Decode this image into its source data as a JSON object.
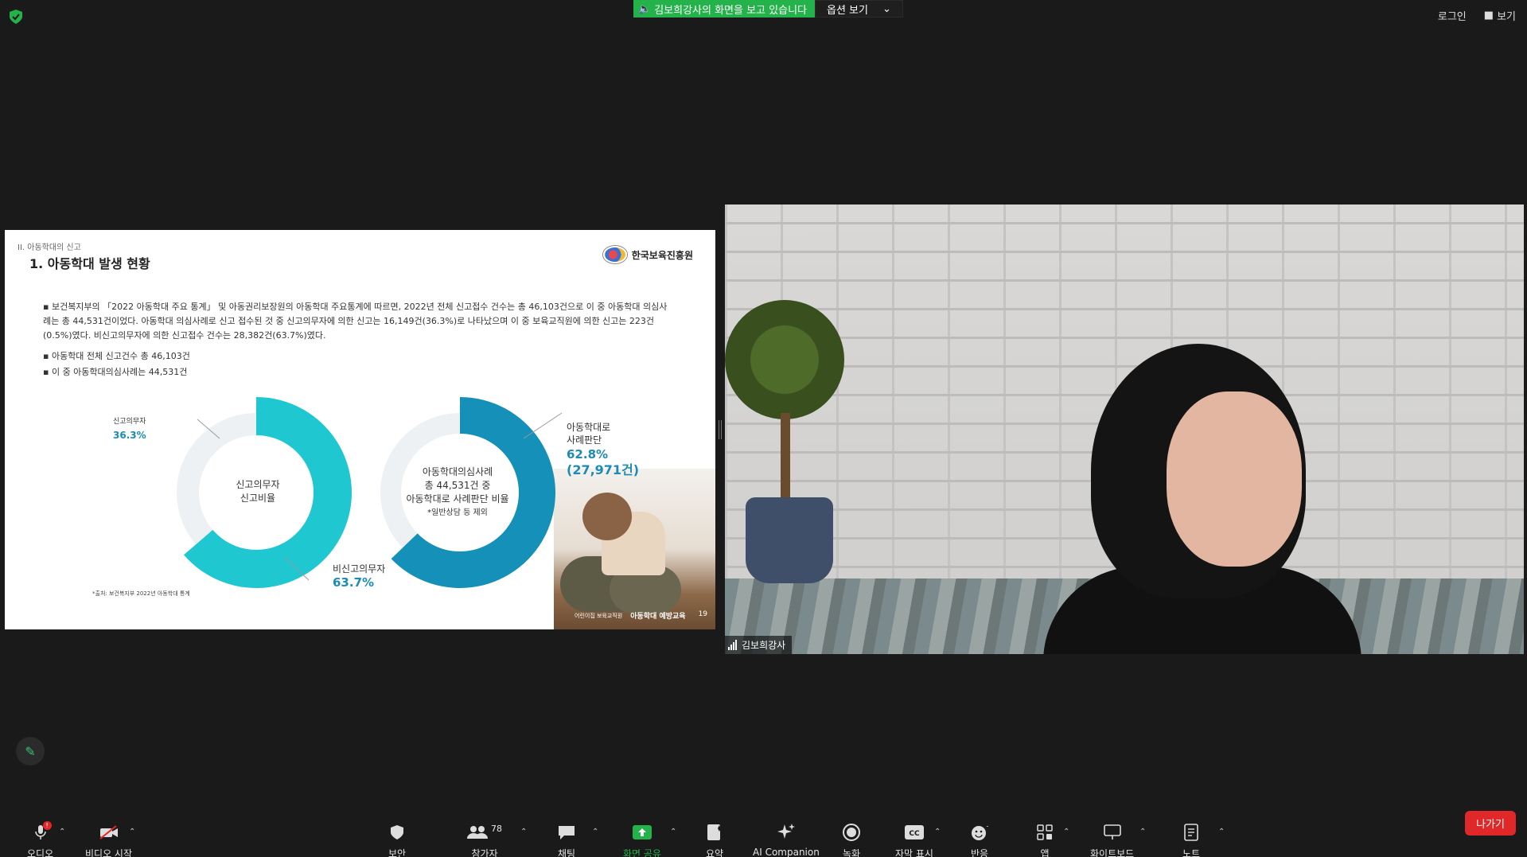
{
  "topbar": {
    "share_text": "김보희강사의 화면을 보고 있습니다",
    "options_label": "옵션 보기",
    "login_label": "로그인",
    "view_label": "보기"
  },
  "slide": {
    "section": "II. 아동학대의 신고",
    "title": "1. 아동학대 발생 현황",
    "logo_text": "한국보육진흥원",
    "paragraph": "▪ 보건복지부의 「2022 아동학대 주요 통계」 및 아동권리보장원의 아동학대 주요통계에 따르면, 2022년 전체 신고접수 건수는 총 46,103건으로 이 중 아동학대 의심사례는 총 44,531건이었다. 아동학대 의심사례로 신고 접수된 것 중 신고의무자에 의한 신고는 16,149건(36.3%)로 나타났으며 이 중 보육교직원에 의한 신고는 223건(0.5%)였다. 비신고의무자에 의한 신고접수 건수는 28,382건(63.7%)였다.",
    "bullet1": "▪ 아동학대 전체 신고건수 총 46,103건",
    "bullet2": "▪ 이 중 아동학대의심사례는 44,531건",
    "source": "*출처: 보건복지부 2022년 아동학대 통계",
    "footer_left": "어린이집 보육교직원",
    "footer_mid": "아동학대 예방교육",
    "page_number": "19",
    "chart1": {
      "center_line1": "신고의무자",
      "center_line2": "신고비율",
      "label_a": "신고의무자",
      "label_a_pct": "36.3%",
      "label_b": "비신고의무자",
      "label_b_pct": "63.7%"
    },
    "chart2": {
      "center_line1": "아동학대의심사례",
      "center_line2": "총 44,531건 중",
      "center_line3": "아동학대로 사례판단 비율",
      "center_line4": "*일반상담 등 제외",
      "label_line1": "아동학대로",
      "label_line2": "사례판단",
      "label_pct": "62.8%",
      "label_count": "(27,971건)"
    }
  },
  "chart_data": [
    {
      "type": "pie",
      "categories": [
        "신고의무자",
        "비신고의무자"
      ],
      "values": [
        36.3,
        63.7
      ]
    },
    {
      "type": "pie",
      "categories": [
        "아동학대로 사례판단"
      ],
      "values": [
        62.8
      ]
    }
  ],
  "video": {
    "participant_name": "김보희강사"
  },
  "toolbar": {
    "audio": "오디오",
    "video": "비디오 시작",
    "security": "보안",
    "participants": "참가자",
    "participants_count": "78",
    "chat": "채팅",
    "share": "화면 공유",
    "summary": "요약",
    "ai": "AI Companion",
    "record": "녹화",
    "captions": "자막 표시",
    "reactions": "반응",
    "apps": "앱",
    "whiteboard": "화이트보드",
    "notes": "노트",
    "leave": "나가기",
    "audio_badge": "!"
  },
  "colors": {
    "accent_green": "#24b24b",
    "leave_red": "#e02828",
    "chart_teal": "#1fc7d0",
    "chart_blue": "#1590b8"
  }
}
